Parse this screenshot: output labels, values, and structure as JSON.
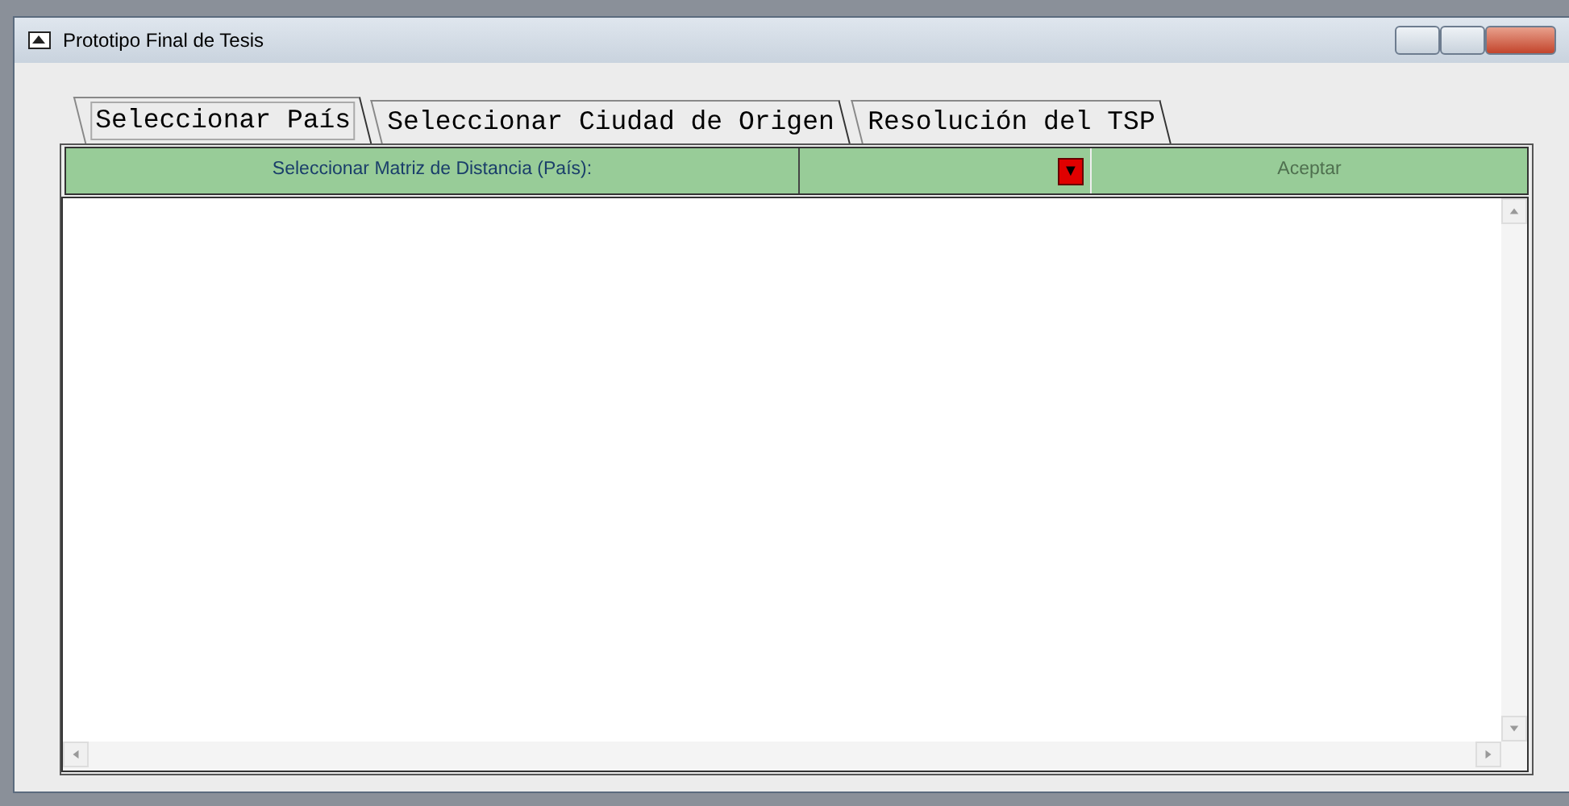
{
  "window": {
    "title": "Prototipo Final de Tesis"
  },
  "tabs": [
    {
      "label": "Seleccionar País",
      "selected": true
    },
    {
      "label": "Seleccionar Ciudad de Origen",
      "selected": false
    },
    {
      "label": "Resolución del TSP",
      "selected": false
    }
  ],
  "toolbar": {
    "label": "Seleccionar Matriz de Distancia (País):",
    "dropdown_arrow": "▼",
    "button": {
      "label": "Aceptar",
      "disabled": true
    }
  }
}
